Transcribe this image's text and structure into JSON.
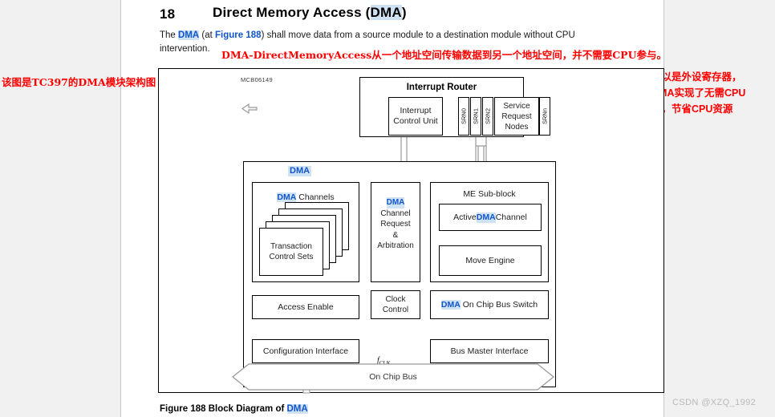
{
  "document": {
    "heading_number": "18",
    "heading_title_pre": "Direct Memory Access (",
    "heading_title_dma": "DMA",
    "heading_title_post": ")",
    "paragraph_line1_a": "The ",
    "paragraph_line1_dma": "DMA",
    "paragraph_line1_b": " (at ",
    "paragraph_line1_figref": "Figure 188",
    "paragraph_line1_c": ") shall move data from a source module to a destination module without CPU",
    "paragraph_line2": "intervention.",
    "caption_pre": "Figure 188   Block Diagram of ",
    "caption_dma": "DMA",
    "watermark": "CSDN @XZQ_1992",
    "figure_code": "MCB06149"
  },
  "annotations": {
    "inline_red": "DMA-DirectMemoryAccess从一个地址空间传输数据到另一个地址空间，并不需要CPU参与。",
    "left_red": "该图是TC397的DMA模块架构图",
    "right_red_line1": "这里的地址空间，可以是外设寄存器，",
    "right_red_line2": "也可以是存储器，DMA实现了无需CPU",
    "right_red_line3": "参与的高速数据传输，节省CPU资源",
    "color": "#ff0000"
  },
  "diagram": {
    "interrupt_router": {
      "title": "Interrupt Router",
      "interrupt_control_unit": "Interrupt Control Unit",
      "srn_labels": [
        "SRN0",
        "SRN1",
        "SRN2"
      ],
      "service_request_nodes": "Service Request Nodes",
      "srnn_label": "SRNn"
    },
    "dma": {
      "title": "DMA",
      "dma_channels_pre": "DMA",
      "dma_channels_post": " Channels",
      "transaction_control_sets": "Transaction Control Sets",
      "channel_request_arbitration_l1": "DMA",
      "channel_request_arbitration_l2": "Channel",
      "channel_request_arbitration_l3": "Request",
      "channel_request_arbitration_l4": "&",
      "channel_request_arbitration_l5": "Arbitration",
      "me_subblock_title": "ME Sub-block",
      "active_dma_channel_pre": "Active ",
      "active_dma_channel_mid": "DMA",
      "active_dma_channel_post": " Channel",
      "move_engine": "Move Engine",
      "access_enable": "Access Enable",
      "clock_control_l1": "Clock",
      "clock_control_l2": "Control",
      "on_chip_bus_switch_pre": "DMA",
      "on_chip_bus_switch_post": " On Chip Bus Switch",
      "configuration_interface": "Configuration  Interface",
      "bus_master_interface": "Bus Master Interface"
    },
    "bus": {
      "fclk_main": "f",
      "fclk_sub": "CLK",
      "on_chip_bus": "On Chip Bus"
    },
    "colors": {
      "highlight": "#cfe2f3",
      "link_blue": "#1155cc",
      "page_background": "#ffffff",
      "gutter_background": "#f1f1f1",
      "line": "#000000",
      "arrow_fill": "#ffffff",
      "arrow_stroke": "#9a9a9a"
    }
  }
}
